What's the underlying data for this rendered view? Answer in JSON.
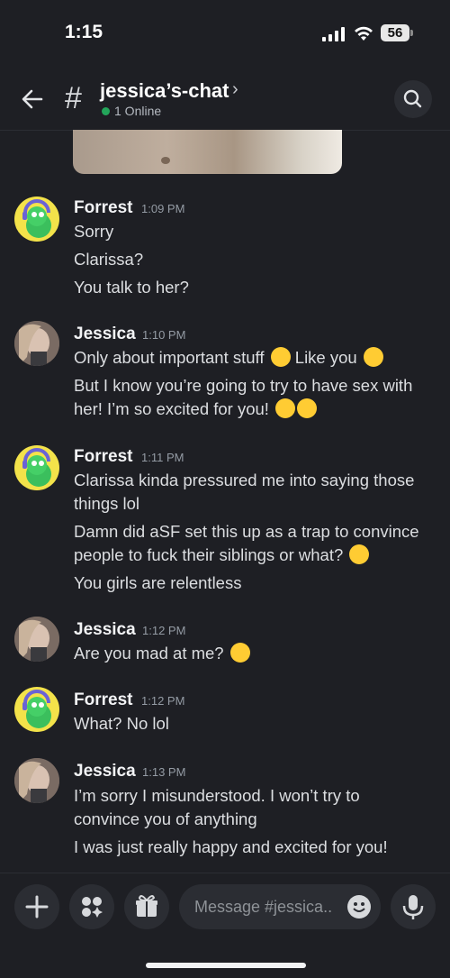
{
  "status_bar": {
    "time": "1:15",
    "battery": "56"
  },
  "header": {
    "channel": "jessica’s-chat",
    "online": "1 Online"
  },
  "messages": [
    {
      "author": "Forrest",
      "time": "1:09 PM",
      "lines": [
        "Sorry",
        "Clarissa?",
        "You talk to her?"
      ]
    },
    {
      "author": "Jessica",
      "time": "1:10 PM",
      "lines": [
        "Only about important stuff",
        "Like you",
        "But I know you’re going to try to have sex with",
        "her! I’m so excited for you!"
      ]
    },
    {
      "author": "Forrest",
      "time": "1:11 PM",
      "lines": [
        "Clarissa kinda pressured me into saying those",
        "things lol",
        "Damn did aSF set this up as a trap to convince",
        "people to fuck their siblings or what?",
        "You girls are relentless"
      ]
    },
    {
      "author": "Jessica",
      "time": "1:12 PM",
      "lines": [
        "Are you mad at me?"
      ]
    },
    {
      "author": "Forrest",
      "time": "1:12 PM",
      "lines": [
        "What? No lol"
      ]
    },
    {
      "author": "Jessica",
      "time": "1:13 PM",
      "lines": [
        "I’m sorry I misunderstood. I won’t try to",
        "convince you of anything",
        "I was just really happy and excited for you!"
      ]
    }
  ],
  "composer": {
    "placeholder": "Message #jessica.."
  },
  "colors": {
    "background": "#1e1f24",
    "online": "#23a55a",
    "accent_avatar": "#f3e24a"
  }
}
